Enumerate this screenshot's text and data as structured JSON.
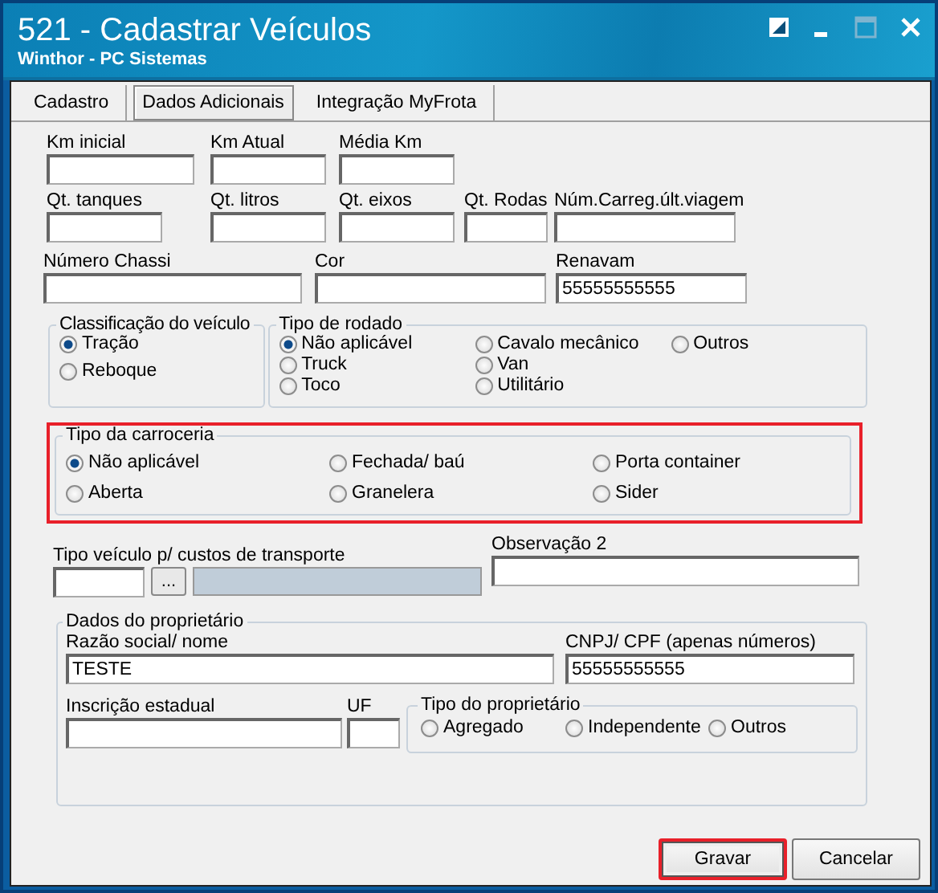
{
  "window": {
    "title": "521 - Cadastrar Veículos",
    "subtitle": "Winthor - PC Sistemas"
  },
  "tabs": [
    {
      "label": "Cadastro",
      "selected": false
    },
    {
      "label": "Dados Adicionais",
      "selected": true
    },
    {
      "label": "Integração MyFrota",
      "selected": false
    }
  ],
  "field_rows": [
    [
      {
        "label": "Km inicial"
      },
      {
        "label": "Km Atual"
      },
      {
        "label": "Média Km"
      }
    ],
    [
      {
        "label": "Qt. tanques"
      },
      {
        "label": "Qt. litros"
      },
      {
        "label": "Qt. eixos"
      },
      {
        "label": "Qt. Rodas"
      },
      {
        "label": "Núm.Carreg.últ.viagem"
      }
    ],
    [
      {
        "label": "Número Chassi"
      },
      {
        "label": "Cor"
      },
      {
        "label": "Renavam",
        "value": "55555555555"
      }
    ]
  ],
  "classificacao": {
    "title": "Classificação do veículo",
    "options": [
      {
        "label": "Tração",
        "selected": true
      },
      {
        "label": "Reboque",
        "selected": false
      }
    ]
  },
  "rodado": {
    "title": "Tipo de rodado",
    "options": [
      {
        "label": "Não aplicável",
        "selected": true
      },
      {
        "label": "Truck",
        "selected": false
      },
      {
        "label": "Toco",
        "selected": false
      },
      {
        "label": "Cavalo mecânico",
        "selected": false
      },
      {
        "label": "Van",
        "selected": false
      },
      {
        "label": "Utilitário",
        "selected": false
      },
      {
        "label": "Outros",
        "selected": false
      }
    ]
  },
  "carroceria": {
    "title": "Tipo da carroceria",
    "highlighted": true,
    "options": [
      {
        "label": "Não aplicável",
        "selected": true
      },
      {
        "label": "Aberta",
        "selected": false
      },
      {
        "label": "Fechada/ baú",
        "selected": false
      },
      {
        "label": "Granelera",
        "selected": false
      },
      {
        "label": "Porta container",
        "selected": false
      },
      {
        "label": "Sider",
        "selected": false
      }
    ]
  },
  "tipo_veiculo": {
    "label": "Tipo veículo p/ custos de transporte",
    "button": "..."
  },
  "observacao": {
    "label": "Observação 2"
  },
  "proprietario": {
    "title": "Dados do proprietário",
    "razao": {
      "label": "Razão social/ nome",
      "value": "TESTE"
    },
    "cnpj": {
      "label": "CNPJ/ CPF (apenas números)",
      "value": "55555555555"
    },
    "inscricao": {
      "label": "Inscrição estadual"
    },
    "uf": {
      "label": "UF"
    },
    "tipo": {
      "title": "Tipo do proprietário",
      "options": [
        {
          "label": "Agregado",
          "selected": false
        },
        {
          "label": "Independente",
          "selected": false
        },
        {
          "label": "Outros",
          "selected": false
        }
      ]
    }
  },
  "buttons": [
    {
      "label": "Gravar",
      "highlighted": true
    },
    {
      "label": "Cancelar",
      "highlighted": false
    }
  ]
}
